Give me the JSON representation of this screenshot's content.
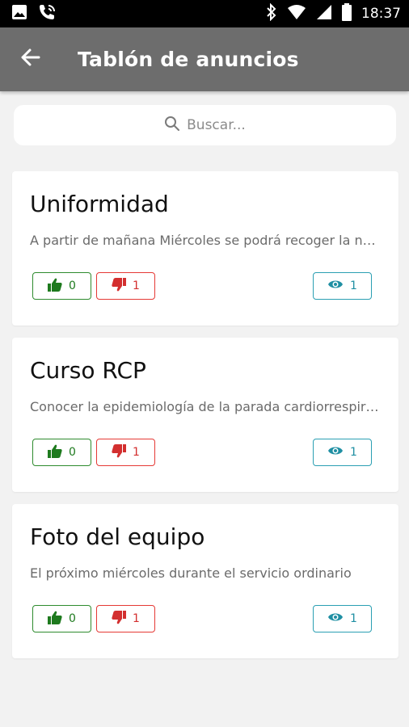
{
  "status_bar": {
    "time": "18:37"
  },
  "app_bar": {
    "title": "Tablón de anuncios"
  },
  "search": {
    "placeholder": "Buscar..."
  },
  "colors": {
    "app_bar": "#6d6d6d",
    "like": "#2e8b2e",
    "dislike": "#e53935",
    "views": "#2b9fb3"
  },
  "announcements": [
    {
      "title": "Uniformidad",
      "excerpt": "A partir de mañana Miércoles se podrá recoger la nueva uniformidad",
      "likes": "0",
      "dislikes": "1",
      "views": "1"
    },
    {
      "title": "Curso RCP",
      "excerpt": "Conocer la epidemiología de la parada cardiorrespiratoria",
      "likes": "0",
      "dislikes": "1",
      "views": "1"
    },
    {
      "title": "Foto del equipo",
      "excerpt": "El próximo miércoles durante el servicio ordinario",
      "likes": "0",
      "dislikes": "1",
      "views": "1"
    }
  ]
}
